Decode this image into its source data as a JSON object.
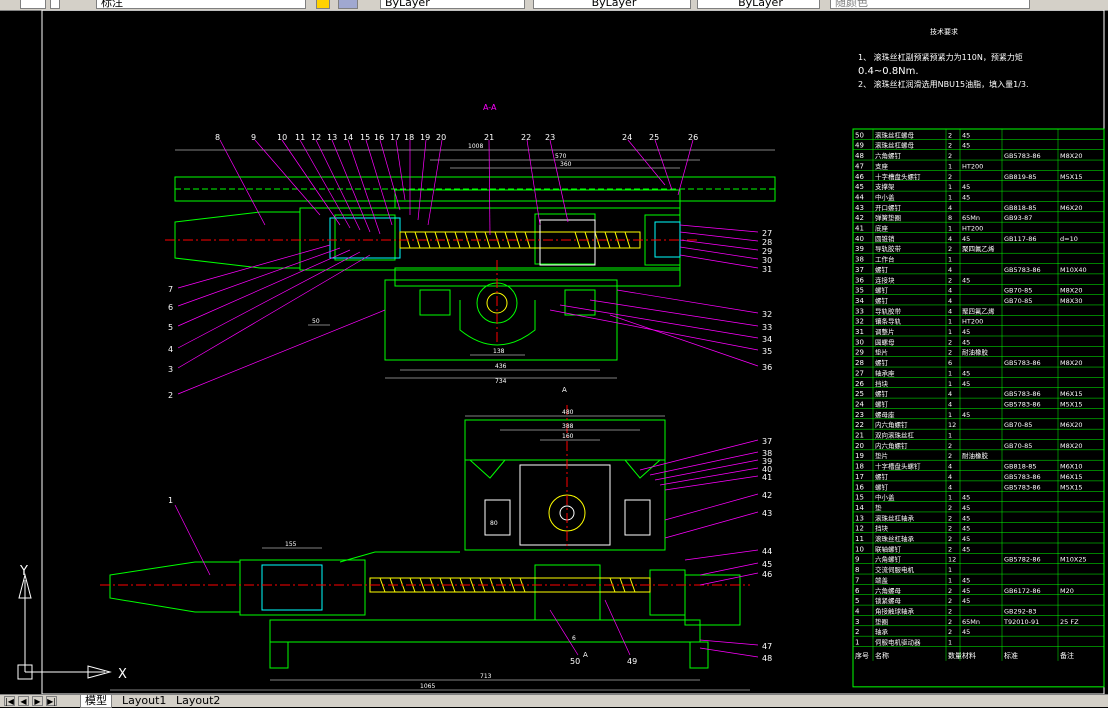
{
  "toolbar": {
    "style_value": "标注",
    "color_value": "ByLayer",
    "linetype_value": "ByLayer",
    "lineweight_value": "ByLayer",
    "plotstyle_value": "随颜色"
  },
  "drawing": {
    "notes_title": "技术要求",
    "note1a": "1、 滚珠丝杠副预紧预紧力为110N，预紧力矩",
    "note1b": "0.4~0.8Nm.",
    "note2": "2、 滚珠丝杠润滑选用NBU15油脂，填入量1/3.",
    "section_label": "A-A",
    "section_marker": "A",
    "top_callouts": [
      "8",
      "9",
      "10",
      "11",
      "12",
      "13",
      "14",
      "15",
      "16",
      "17",
      "18",
      "19",
      "20",
      "21",
      "22",
      "23",
      "24",
      "25",
      "26"
    ],
    "right_callouts": [
      "27",
      "28",
      "29",
      "30",
      "31",
      "32",
      "33",
      "34",
      "35",
      "36",
      "37",
      "38",
      "39",
      "40",
      "41",
      "42",
      "43",
      "44",
      "45",
      "46",
      "47",
      "48"
    ],
    "left_callouts": [
      "7",
      "6",
      "5",
      "4",
      "3",
      "2",
      "1"
    ],
    "bottom_callouts": [
      "50",
      "49"
    ],
    "dims": {
      "top_width": "1008",
      "top_mid": "570",
      "top_inner": "360",
      "top_small": "50",
      "top_base": "436",
      "top_foot": "734",
      "top_bore": "138",
      "mid_width": "480",
      "mid_inner": "388",
      "mid_small": "160",
      "mid_bore": "80",
      "bot_left": "155",
      "bot_base": "713",
      "bot_total": "1065",
      "bot_small": "6"
    }
  },
  "bom": {
    "header": [
      "序号",
      "名称",
      "数量",
      "材料",
      "标准",
      "备注"
    ],
    "rows": [
      {
        "no": "50",
        "name": "滚珠丝杠螺母",
        "qty": "2",
        "mat": "45",
        "std": "",
        "note": ""
      },
      {
        "no": "49",
        "name": "滚珠丝杠螺母",
        "qty": "2",
        "mat": "45",
        "std": "",
        "note": ""
      },
      {
        "no": "48",
        "name": "六角螺钉",
        "qty": "2",
        "mat": "",
        "std": "GB5783-86",
        "note": "M8X20"
      },
      {
        "no": "47",
        "name": "支座",
        "qty": "1",
        "mat": "HT200",
        "std": "",
        "note": ""
      },
      {
        "no": "46",
        "name": "十字槽盘头螺钉",
        "qty": "2",
        "mat": "",
        "std": "GB819-85",
        "note": "M5X15"
      },
      {
        "no": "45",
        "name": "支撑架",
        "qty": "1",
        "mat": "45",
        "std": "",
        "note": ""
      },
      {
        "no": "44",
        "name": "中小盖",
        "qty": "1",
        "mat": "45",
        "std": "",
        "note": ""
      },
      {
        "no": "43",
        "name": "开口螺钉",
        "qty": "4",
        "mat": "",
        "std": "GB818-85",
        "note": "M6X20"
      },
      {
        "no": "42",
        "name": "弹簧垫圈",
        "qty": "8",
        "mat": "65Mn",
        "std": "GB93-87",
        "note": ""
      },
      {
        "no": "41",
        "name": "底座",
        "qty": "1",
        "mat": "HT200",
        "std": "",
        "note": ""
      },
      {
        "no": "40",
        "name": "圆锥销",
        "qty": "4",
        "mat": "45",
        "std": "GB117-86",
        "note": "d=10"
      },
      {
        "no": "39",
        "name": "导轨胶带",
        "qty": "2",
        "mat": "聚四氟乙烯",
        "std": "",
        "note": ""
      },
      {
        "no": "38",
        "name": "工作台",
        "qty": "1",
        "mat": "",
        "std": "",
        "note": ""
      },
      {
        "no": "37",
        "name": "螺钉",
        "qty": "4",
        "mat": "",
        "std": "GB5783-86",
        "note": "M10X40"
      },
      {
        "no": "36",
        "name": "连接块",
        "qty": "2",
        "mat": "45",
        "std": "",
        "note": ""
      },
      {
        "no": "35",
        "name": "螺钉",
        "qty": "4",
        "mat": "",
        "std": "GB70-85",
        "note": "M8X20"
      },
      {
        "no": "34",
        "name": "螺钉",
        "qty": "4",
        "mat": "",
        "std": "GB70-85",
        "note": "M8X30"
      },
      {
        "no": "33",
        "name": "导轨胶带",
        "qty": "4",
        "mat": "聚四氟乙烯",
        "std": "",
        "note": ""
      },
      {
        "no": "32",
        "name": "镶条导轨",
        "qty": "1",
        "mat": "HT200",
        "std": "",
        "note": ""
      },
      {
        "no": "31",
        "name": "调整片",
        "qty": "1",
        "mat": "45",
        "std": "",
        "note": ""
      },
      {
        "no": "30",
        "name": "圆螺母",
        "qty": "2",
        "mat": "45",
        "std": "",
        "note": ""
      },
      {
        "no": "29",
        "name": "垫片",
        "qty": "2",
        "mat": "耐油橡胶",
        "std": "",
        "note": ""
      },
      {
        "no": "28",
        "name": "螺钉",
        "qty": "6",
        "mat": "",
        "std": "GB5783-86",
        "note": "M8X20"
      },
      {
        "no": "27",
        "name": "轴承座",
        "qty": "1",
        "mat": "45",
        "std": "",
        "note": ""
      },
      {
        "no": "26",
        "name": "挡块",
        "qty": "1",
        "mat": "45",
        "std": "",
        "note": ""
      },
      {
        "no": "25",
        "name": "螺钉",
        "qty": "4",
        "mat": "",
        "std": "GB5783-86",
        "note": "M6X15"
      },
      {
        "no": "24",
        "name": "螺钉",
        "qty": "4",
        "mat": "",
        "std": "GB5783-86",
        "note": "M5X15"
      },
      {
        "no": "23",
        "name": "螺母座",
        "qty": "1",
        "mat": "45",
        "std": "",
        "note": ""
      },
      {
        "no": "22",
        "name": "内六角螺钉",
        "qty": "12",
        "mat": "",
        "std": "GB70-85",
        "note": "M6X20"
      },
      {
        "no": "21",
        "name": "双向滚珠丝杠",
        "qty": "1",
        "mat": "",
        "std": "",
        "note": ""
      },
      {
        "no": "20",
        "name": "内六角螺钉",
        "qty": "2",
        "mat": "",
        "std": "GB70-85",
        "note": "M8X20"
      },
      {
        "no": "19",
        "name": "垫片",
        "qty": "2",
        "mat": "耐油橡胶",
        "std": "",
        "note": ""
      },
      {
        "no": "18",
        "name": "十字槽盘头螺钉",
        "qty": "4",
        "mat": "",
        "std": "GB818-85",
        "note": "M6X10"
      },
      {
        "no": "17",
        "name": "螺钉",
        "qty": "4",
        "mat": "",
        "std": "GB5783-86",
        "note": "M6X15"
      },
      {
        "no": "16",
        "name": "螺钉",
        "qty": "4",
        "mat": "",
        "std": "GB5783-86",
        "note": "M5X15"
      },
      {
        "no": "15",
        "name": "中小盖",
        "qty": "1",
        "mat": "45",
        "std": "",
        "note": ""
      },
      {
        "no": "14",
        "name": "垫",
        "qty": "2",
        "mat": "45",
        "std": "",
        "note": ""
      },
      {
        "no": "13",
        "name": "滚珠丝杠轴承",
        "qty": "2",
        "mat": "45",
        "std": "",
        "note": ""
      },
      {
        "no": "12",
        "name": "挡块",
        "qty": "2",
        "mat": "45",
        "std": "",
        "note": ""
      },
      {
        "no": "11",
        "name": "滚珠丝杠轴承",
        "qty": "2",
        "mat": "45",
        "std": "",
        "note": ""
      },
      {
        "no": "10",
        "name": "联轴螺钉",
        "qty": "2",
        "mat": "45",
        "std": "",
        "note": ""
      },
      {
        "no": "9",
        "name": "六角螺钉",
        "qty": "12",
        "mat": "",
        "std": "GB5782-86",
        "note": "M10X25"
      },
      {
        "no": "8",
        "name": "交流伺服电机",
        "qty": "1",
        "mat": "",
        "std": "",
        "note": ""
      },
      {
        "no": "7",
        "name": "端盖",
        "qty": "1",
        "mat": "45",
        "std": "",
        "note": ""
      },
      {
        "no": "6",
        "name": "六角螺母",
        "qty": "2",
        "mat": "45",
        "std": "GB6172-86",
        "note": "M20"
      },
      {
        "no": "5",
        "name": "锁紧螺母",
        "qty": "2",
        "mat": "45",
        "std": "",
        "note": ""
      },
      {
        "no": "4",
        "name": "角接触球轴承",
        "qty": "2",
        "mat": "",
        "std": "GB292-83",
        "note": ""
      },
      {
        "no": "3",
        "name": "垫圈",
        "qty": "2",
        "mat": "65Mn",
        "std": "T92010-91",
        "note": "25 FZ"
      },
      {
        "no": "2",
        "name": "轴承",
        "qty": "2",
        "mat": "45",
        "std": "",
        "note": ""
      },
      {
        "no": "1",
        "name": "伺服电机驱动器",
        "qty": "1",
        "mat": "",
        "std": "",
        "note": ""
      }
    ]
  },
  "axes": {
    "y_label": "Y",
    "x_label": "X"
  },
  "tabs": {
    "model": "模型",
    "layout1": "Layout1",
    "layout2": "Layout2"
  },
  "colors": {
    "background": "#000000",
    "geometry": "#00ff00",
    "leader": "#ff00ff",
    "text": "#ffffff",
    "center": "#ff0000",
    "hatch": "#00ffff",
    "table_line": "#00ff00",
    "table_text": "#ffffff"
  }
}
